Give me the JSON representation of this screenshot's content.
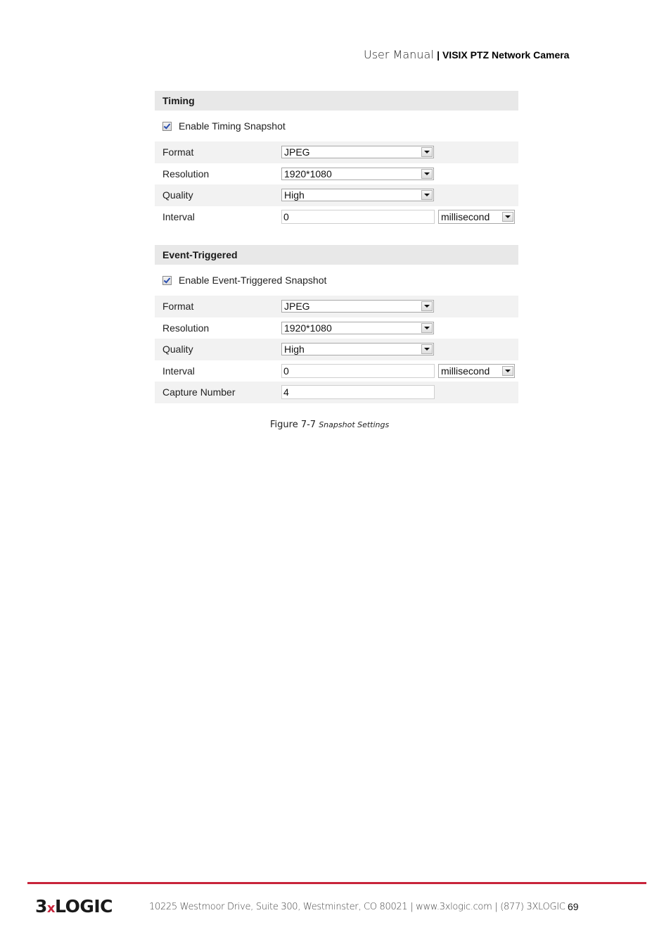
{
  "header": {
    "title": "User Manual",
    "separator_product": "| VISIX PTZ Network Camera"
  },
  "timing": {
    "section_title": "Timing",
    "enable_label": "Enable Timing Snapshot",
    "enable_checked": true,
    "rows": {
      "format": {
        "label": "Format",
        "value": "JPEG"
      },
      "resolution": {
        "label": "Resolution",
        "value": "1920*1080"
      },
      "quality": {
        "label": "Quality",
        "value": "High"
      },
      "interval": {
        "label": "Interval",
        "value": "0",
        "unit": "millisecond"
      }
    }
  },
  "event": {
    "section_title": "Event-Triggered",
    "enable_label": "Enable Event-Triggered Snapshot",
    "enable_checked": true,
    "rows": {
      "format": {
        "label": "Format",
        "value": "JPEG"
      },
      "resolution": {
        "label": "Resolution",
        "value": "1920*1080"
      },
      "quality": {
        "label": "Quality",
        "value": "High"
      },
      "interval": {
        "label": "Interval",
        "value": "0",
        "unit": "millisecond"
      },
      "capture_number": {
        "label": "Capture Number",
        "value": "4"
      }
    }
  },
  "caption": {
    "prefix": "Figure 7-7",
    "title": "Snapshot Settings"
  },
  "footer": {
    "logo_left": "3",
    "logo_x": "x",
    "logo_right": "LOGIC",
    "address": "10225 Westmoor Drive, Suite 300, Westminster, CO 80021 | www.3xlogic.com | (877) 3XLOGIC",
    "page_number": "69"
  },
  "colors": {
    "brand_red": "#c8243b",
    "section_bg": "#e8e8e8",
    "row_shade": "#f2f2f2"
  }
}
